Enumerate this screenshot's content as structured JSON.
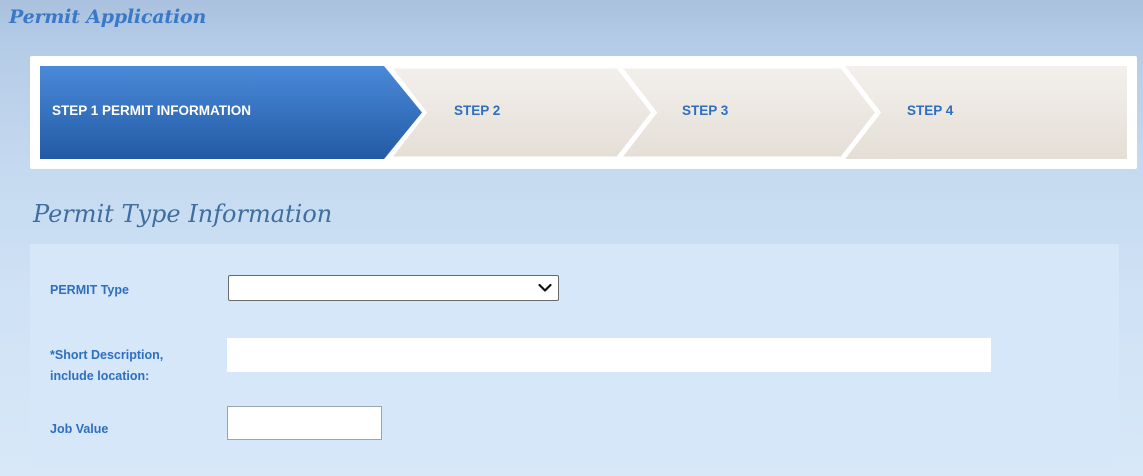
{
  "app": {
    "title": "Permit Application"
  },
  "wizard": {
    "steps": [
      {
        "label": "STEP 1  PERMIT INFORMATION",
        "active": true
      },
      {
        "label": "STEP 2",
        "active": false
      },
      {
        "label": "STEP 3",
        "active": false
      },
      {
        "label": "STEP 4",
        "active": false
      }
    ]
  },
  "section": {
    "title": "Permit Type Information"
  },
  "form": {
    "permit_type": {
      "label": "PERMIT Type",
      "value": ""
    },
    "short_description": {
      "label_line1": "*Short Description,",
      "label_line2": "include location:",
      "value": ""
    },
    "job_value": {
      "label": "Job Value",
      "value": ""
    }
  },
  "colors": {
    "active_step": "#2f6fc0",
    "inactive_step": "#ebe6e0",
    "label_text": "#2f6ec0",
    "title_text": "#3a78c8",
    "panel": "#d5e7f9"
  },
  "icons": {
    "select": "chevron-down-icon"
  }
}
